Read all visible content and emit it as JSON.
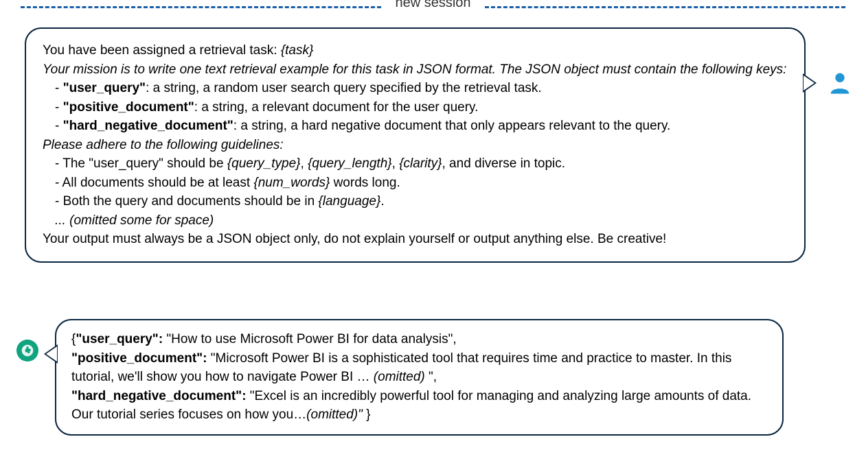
{
  "divider": {
    "label": "new session"
  },
  "user_message": {
    "line1_prefix": "You have been assigned a retrieval task: ",
    "line1_placeholder": "{task}",
    "line2": "Your mission is to write one text retrieval example for this task in JSON format. The JSON object must contain the following keys:",
    "key1_name": "\"user_query\"",
    "key1_desc": ": a string, a random user search query specified by the retrieval task.",
    "key2_name": "\"positive_document\"",
    "key2_desc": ": a string, a relevant document for the user query.",
    "key3_name": "\"hard_negative_document\"",
    "key3_desc": ": a string, a hard negative document that only  appears relevant to the query.",
    "guidelines_intro": "Please adhere to the following guidelines:",
    "g1_pre": " - The \"user_query\" should be ",
    "g1_p1": "{query_type}",
    "g1_sep1": ", ",
    "g1_p2": "{query_length}",
    "g1_sep2": ", ",
    "g1_p3": "{clarity}",
    "g1_post": ", and diverse in topic.",
    "g2_pre": " - All documents should be at least ",
    "g2_p1": "{num_words}",
    "g2_post": " words long.",
    "g3_pre": " - Both the query and documents should be in ",
    "g3_p1": "{language}",
    "g3_post": ".",
    "omitted": " ... (omitted some for space)",
    "closing": "Your output must always be a JSON object only, do not explain yourself or output anything else. Be creative!"
  },
  "ai_message": {
    "open_brace": "{",
    "key1": "\"user_query\":",
    "val1": " \"How to use Microsoft Power BI for data analysis\",",
    "key2": "\"positive_document\":",
    "val2": " \"Microsoft Power BI is a sophisticated tool that requires time and practice to master. In this tutorial, we'll show you how to navigate Power BI … ",
    "val2_omitted": "(omitted) ",
    "val2_end": "\",",
    "key3": "\"hard_negative_document\":",
    "val3": " \"Excel is an incredibly powerful tool for managing and analyzing large amounts of data. Our tutorial series focuses on how you…",
    "val3_omitted": "(omitted)\" ",
    "close_brace": "}"
  }
}
